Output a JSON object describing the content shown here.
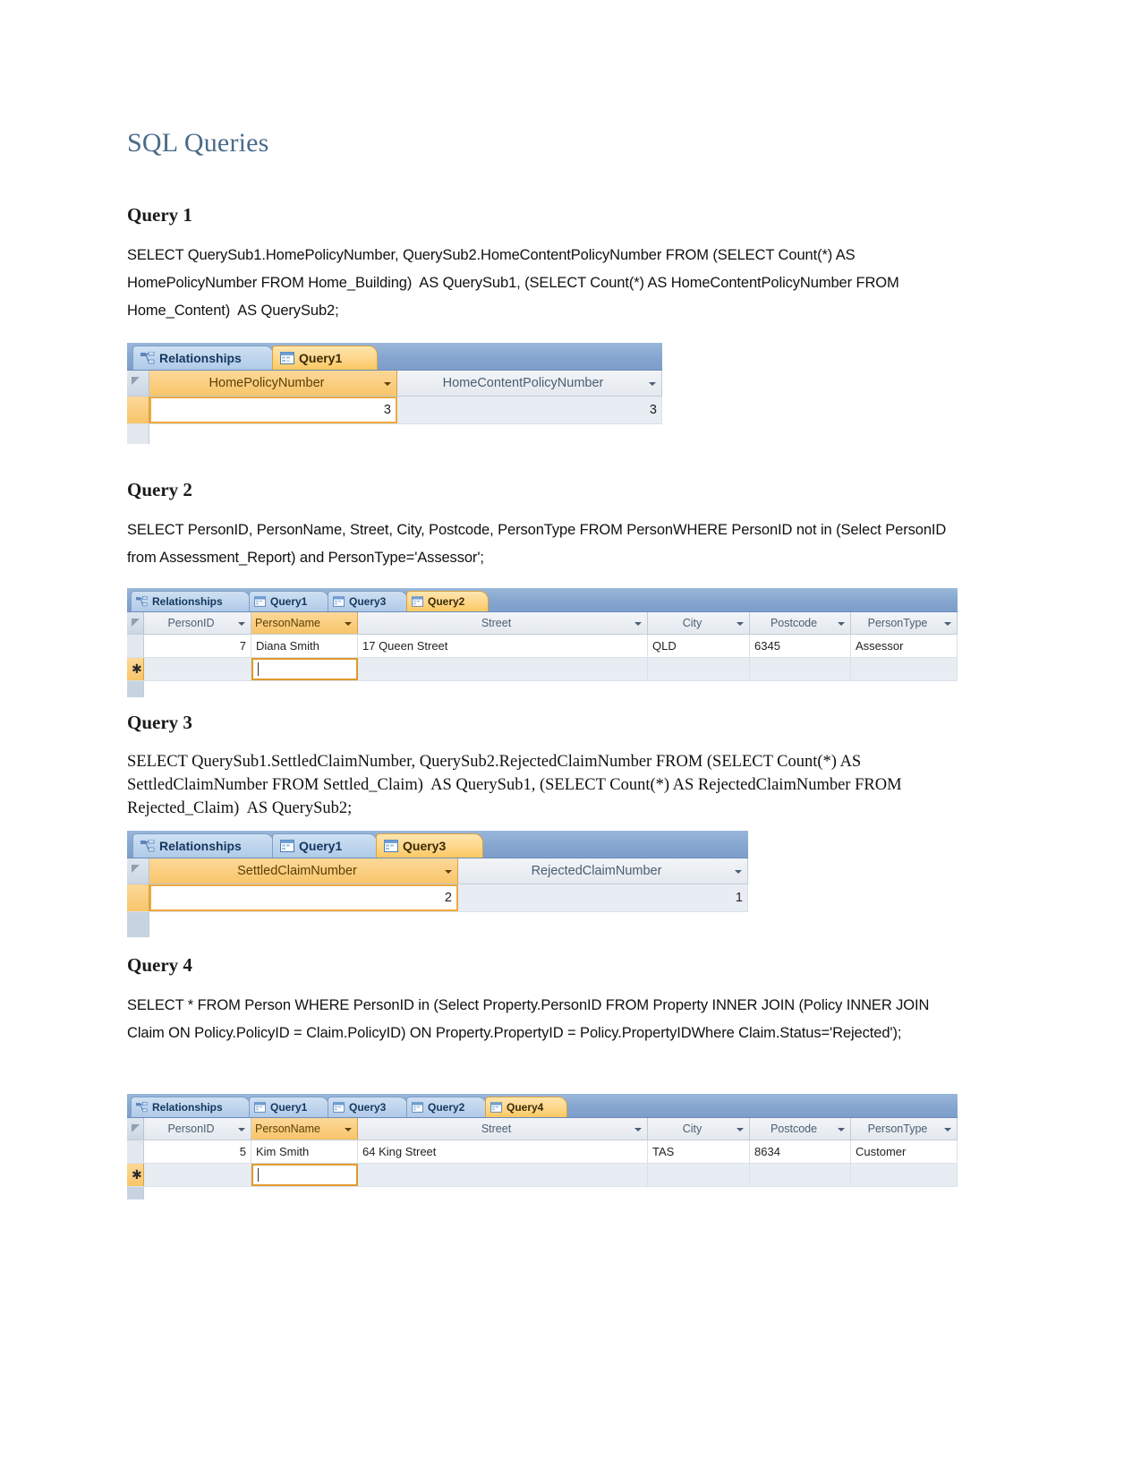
{
  "document": {
    "title": "SQL Queries"
  },
  "sections": [
    {
      "heading": "Query 1",
      "sql": "SELECT QuerySub1.HomePolicyNumber, QuerySub2.HomeContentPolicyNumber FROM (SELECT Count(*) AS HomePolicyNumber FROM Home_Building)  AS QuerySub1, (SELECT Count(*) AS HomeContentPolicyNumber FROM Home_Content)  AS QuerySub2;",
      "sql_font": "sans"
    },
    {
      "heading": "Query 2",
      "sql": "SELECT PersonID, PersonName, Street, City, Postcode, PersonType FROM PersonWHERE PersonID not in (Select PersonID from Assessment_Report) and PersonType='Assessor';",
      "sql_font": "sans"
    },
    {
      "heading": "Query 3",
      "sql": "SELECT QuerySub1.SettledClaimNumber, QuerySub2.RejectedClaimNumber FROM (SELECT Count(*) AS SettledClaimNumber FROM Settled_Claim)  AS QuerySub1, (SELECT Count(*) AS RejectedClaimNumber FROM Rejected_Claim)  AS QuerySub2;",
      "sql_font": "serif"
    },
    {
      "heading": "Query 4",
      "sql": "SELECT * FROM Person WHERE PersonID in (Select Property.PersonID FROM Property INNER JOIN (Policy INNER JOIN Claim ON Policy.PolicyID = Claim.PolicyID) ON Property.PropertyID = Policy.PropertyIDWhere Claim.Status='Rejected');",
      "sql_font": "sans"
    }
  ],
  "screenshots": {
    "query1": {
      "tabs": [
        {
          "label": "Relationships",
          "icon": "relationships-icon",
          "active": false
        },
        {
          "label": "Query1",
          "icon": "query-datasheet-icon",
          "active": true
        }
      ],
      "columns": [
        {
          "label": "HomePolicyNumber",
          "selected": true,
          "has_caret": true
        },
        {
          "label": "HomeContentPolicyNumber",
          "selected": false,
          "has_caret": true
        }
      ],
      "rows": [
        {
          "cells": [
            "3",
            "3"
          ]
        }
      ]
    },
    "query2": {
      "tabs": [
        {
          "label": "Relationships",
          "icon": "relationships-icon",
          "active": false
        },
        {
          "label": "Query1",
          "icon": "query-datasheet-icon",
          "active": false
        },
        {
          "label": "Query3",
          "icon": "query-datasheet-icon",
          "active": false
        },
        {
          "label": "Query2",
          "icon": "query-datasheet-icon",
          "active": true
        }
      ],
      "columns": [
        {
          "label": "PersonID",
          "selected": false,
          "has_caret": true
        },
        {
          "label": "PersonName",
          "selected": true,
          "has_caret": true
        },
        {
          "label": "Street",
          "selected": false,
          "has_caret": true
        },
        {
          "label": "City",
          "selected": false,
          "has_caret": true
        },
        {
          "label": "Postcode",
          "selected": false,
          "has_caret": true
        },
        {
          "label": "PersonType",
          "selected": false,
          "has_caret": true
        }
      ],
      "rows": [
        {
          "cells": [
            "7",
            "Diana Smith",
            "17 Queen Street",
            "QLD",
            "6345",
            "Assessor"
          ]
        }
      ],
      "new_row_marker": "*"
    },
    "query3": {
      "tabs": [
        {
          "label": "Relationships",
          "icon": "relationships-icon",
          "active": false
        },
        {
          "label": "Query1",
          "icon": "query-datasheet-icon",
          "active": false
        },
        {
          "label": "Query3",
          "icon": "query-datasheet-icon",
          "active": true
        }
      ],
      "columns": [
        {
          "label": "SettledClaimNumber",
          "selected": true,
          "has_caret": true
        },
        {
          "label": "RejectedClaimNumber",
          "selected": false,
          "has_caret": true
        }
      ],
      "rows": [
        {
          "cells": [
            "2",
            "1"
          ]
        }
      ]
    },
    "query4": {
      "tabs": [
        {
          "label": "Relationships",
          "icon": "relationships-icon",
          "active": false
        },
        {
          "label": "Query1",
          "icon": "query-datasheet-icon",
          "active": false
        },
        {
          "label": "Query3",
          "icon": "query-datasheet-icon",
          "active": false
        },
        {
          "label": "Query2",
          "icon": "query-datasheet-icon",
          "active": false
        },
        {
          "label": "Query4",
          "icon": "query-datasheet-icon",
          "active": true
        }
      ],
      "columns": [
        {
          "label": "PersonID",
          "selected": false,
          "has_caret": true
        },
        {
          "label": "PersonName",
          "selected": true,
          "has_caret": true
        },
        {
          "label": "Street",
          "selected": false,
          "has_caret": true
        },
        {
          "label": "City",
          "selected": false,
          "has_caret": true
        },
        {
          "label": "Postcode",
          "selected": false,
          "has_caret": true
        },
        {
          "label": "PersonType",
          "selected": false,
          "has_caret": true
        }
      ],
      "rows": [
        {
          "cells": [
            "5",
            "Kim Smith",
            "64 King Street",
            "TAS",
            "8634",
            "Customer"
          ]
        }
      ],
      "new_row_marker": "*"
    }
  },
  "colors": {
    "title": "#4a6b8a",
    "tab_active": "#fcc961",
    "tab_inactive": "#bcd3ec",
    "tabbar": "#86a6cf",
    "selected_column": "#f8c56a"
  }
}
